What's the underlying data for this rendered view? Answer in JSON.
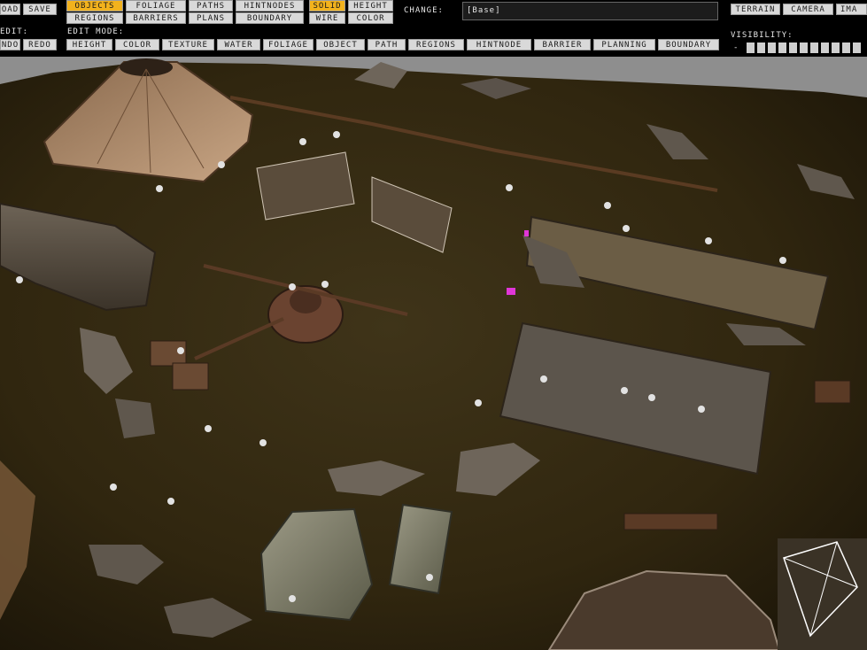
{
  "file": {
    "load": "oad",
    "save": "Save"
  },
  "layers_row1": {
    "objects": "Objects",
    "foliage": "Foliage",
    "paths": "Paths",
    "hintnodes": "HintNodes"
  },
  "layers_row2": {
    "regions": "Regions",
    "barriers": "Barriers",
    "plans": "Plans",
    "boundary": "Boundary"
  },
  "render": {
    "solid": "Solid",
    "height": "Height",
    "wire": "Wire",
    "color": "Color"
  },
  "change": {
    "label": "CHANGE:",
    "value": "[Base]"
  },
  "views": {
    "terrain": "Terrain",
    "camera": "Camera",
    "image": "Ima"
  },
  "edit": {
    "label": "EDIT:",
    "undo": "ndo",
    "redo": "Redo"
  },
  "edit_mode": {
    "label": "EDIT MODE:",
    "height": "Height",
    "color": "Color",
    "texture": "Texture",
    "water": "Water",
    "foliage": "Foliage",
    "object": "Object",
    "path": "Path",
    "regions": "Regions",
    "hintnode": "HintNode",
    "barrier": "Barrier",
    "planning": "Planning",
    "boundary": "Boundary"
  },
  "visibility": {
    "label": "VISIBILITY:",
    "minus": "-"
  },
  "colors": {
    "active": "#f2b21d",
    "button": "#d9d9d9",
    "toolbar": "#000000",
    "ground": "#3a2e15"
  }
}
